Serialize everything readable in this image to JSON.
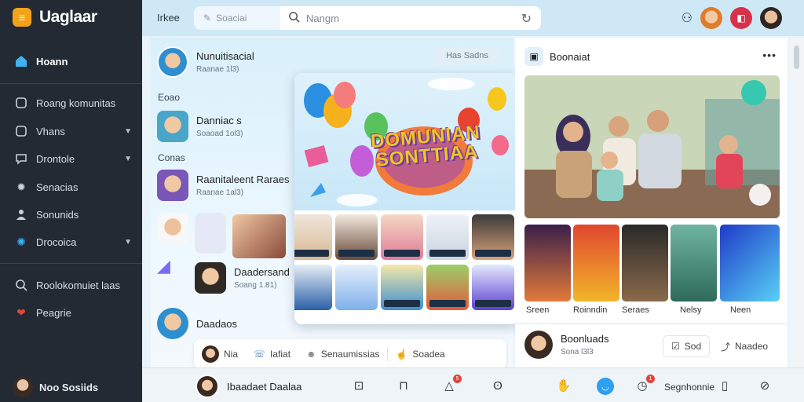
{
  "app": {
    "title": "Uaglaar"
  },
  "sidebar": {
    "items": [
      {
        "label": "Hoann",
        "icon": "home-icon"
      },
      {
        "label": "Roang komunitas",
        "icon": "grid-icon"
      },
      {
        "label": "Vhans",
        "icon": "square-icon"
      },
      {
        "label": "Drontole",
        "icon": "chat-icon"
      },
      {
        "label": "Senacias",
        "icon": "gear-icon"
      },
      {
        "label": "Sonunids",
        "icon": "people-icon"
      },
      {
        "label": "Drocoica",
        "icon": "settings-icon"
      },
      {
        "label": "Roolokomuiet laas",
        "icon": "search-icon"
      },
      {
        "label": "Peagrie",
        "icon": "heart-icon"
      }
    ],
    "user": {
      "name": "Noo Sosiids"
    }
  },
  "topbar": {
    "tab": "Irkee",
    "search_a_placeholder": "Soaciai",
    "search_b_placeholder": "Nangm"
  },
  "feed": {
    "post1": {
      "title": "Nunuitisacial",
      "meta": "Raanae 1l3)"
    },
    "filter_pill": "Has  Sadns",
    "section_a": "Eoao",
    "post2": {
      "title": "Danniac s",
      "meta": "Soaoad 1ol3)"
    },
    "section_b": "Conas",
    "post3": {
      "title": "Raanitaleent Raraes",
      "meta": "Raanae 1al3)"
    },
    "post4": {
      "title": "Daadersand",
      "meta": "Soang 1.81)"
    },
    "post5": {
      "title": "Daadaos"
    },
    "banner_title": "DOMUNIAN SONTTIAA",
    "comment_bar": {
      "item1": "Nia",
      "item2": "Iafiat",
      "item3": "Senaumissias",
      "item4": "Soadea"
    }
  },
  "right": {
    "title": "Boonaiat",
    "tiles": [
      "Sreen",
      "Roinndin",
      "Seraes",
      "Nelsy",
      "Neen"
    ],
    "foot_user": {
      "title": "Boonluads",
      "meta": "Sona l3l3"
    },
    "btn_sod": "Sod",
    "btn_share": "Naadeo"
  },
  "bottombar": {
    "user_name": "Ibaadaet Daalaa",
    "right_label": "Segnhonnie",
    "badges": {
      "bell": "5",
      "clock": "1"
    }
  },
  "colors": {
    "sidebar_bg": "#232a33",
    "accent": "#3fb2f0",
    "brand": "#f3a21c",
    "notify": "#e2453a"
  }
}
